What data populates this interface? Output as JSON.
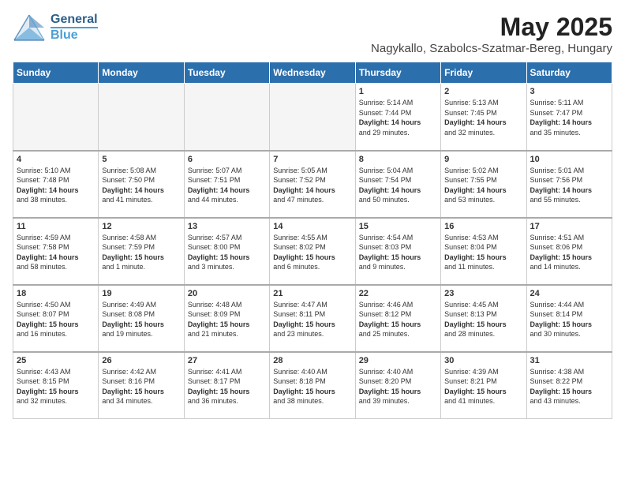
{
  "logo": {
    "line1": "General",
    "line2": "Blue"
  },
  "title": "May 2025",
  "location": "Nagykallo, Szabolcs-Szatmar-Bereg, Hungary",
  "headers": [
    "Sunday",
    "Monday",
    "Tuesday",
    "Wednesday",
    "Thursday",
    "Friday",
    "Saturday"
  ],
  "weeks": [
    [
      {
        "day": "",
        "info": ""
      },
      {
        "day": "",
        "info": ""
      },
      {
        "day": "",
        "info": ""
      },
      {
        "day": "",
        "info": ""
      },
      {
        "day": "1",
        "info": "Sunrise: 5:14 AM\nSunset: 7:44 PM\nDaylight: 14 hours\nand 29 minutes."
      },
      {
        "day": "2",
        "info": "Sunrise: 5:13 AM\nSunset: 7:45 PM\nDaylight: 14 hours\nand 32 minutes."
      },
      {
        "day": "3",
        "info": "Sunrise: 5:11 AM\nSunset: 7:47 PM\nDaylight: 14 hours\nand 35 minutes."
      }
    ],
    [
      {
        "day": "4",
        "info": "Sunrise: 5:10 AM\nSunset: 7:48 PM\nDaylight: 14 hours\nand 38 minutes."
      },
      {
        "day": "5",
        "info": "Sunrise: 5:08 AM\nSunset: 7:50 PM\nDaylight: 14 hours\nand 41 minutes."
      },
      {
        "day": "6",
        "info": "Sunrise: 5:07 AM\nSunset: 7:51 PM\nDaylight: 14 hours\nand 44 minutes."
      },
      {
        "day": "7",
        "info": "Sunrise: 5:05 AM\nSunset: 7:52 PM\nDaylight: 14 hours\nand 47 minutes."
      },
      {
        "day": "8",
        "info": "Sunrise: 5:04 AM\nSunset: 7:54 PM\nDaylight: 14 hours\nand 50 minutes."
      },
      {
        "day": "9",
        "info": "Sunrise: 5:02 AM\nSunset: 7:55 PM\nDaylight: 14 hours\nand 53 minutes."
      },
      {
        "day": "10",
        "info": "Sunrise: 5:01 AM\nSunset: 7:56 PM\nDaylight: 14 hours\nand 55 minutes."
      }
    ],
    [
      {
        "day": "11",
        "info": "Sunrise: 4:59 AM\nSunset: 7:58 PM\nDaylight: 14 hours\nand 58 minutes."
      },
      {
        "day": "12",
        "info": "Sunrise: 4:58 AM\nSunset: 7:59 PM\nDaylight: 15 hours\nand 1 minute."
      },
      {
        "day": "13",
        "info": "Sunrise: 4:57 AM\nSunset: 8:00 PM\nDaylight: 15 hours\nand 3 minutes."
      },
      {
        "day": "14",
        "info": "Sunrise: 4:55 AM\nSunset: 8:02 PM\nDaylight: 15 hours\nand 6 minutes."
      },
      {
        "day": "15",
        "info": "Sunrise: 4:54 AM\nSunset: 8:03 PM\nDaylight: 15 hours\nand 9 minutes."
      },
      {
        "day": "16",
        "info": "Sunrise: 4:53 AM\nSunset: 8:04 PM\nDaylight: 15 hours\nand 11 minutes."
      },
      {
        "day": "17",
        "info": "Sunrise: 4:51 AM\nSunset: 8:06 PM\nDaylight: 15 hours\nand 14 minutes."
      }
    ],
    [
      {
        "day": "18",
        "info": "Sunrise: 4:50 AM\nSunset: 8:07 PM\nDaylight: 15 hours\nand 16 minutes."
      },
      {
        "day": "19",
        "info": "Sunrise: 4:49 AM\nSunset: 8:08 PM\nDaylight: 15 hours\nand 19 minutes."
      },
      {
        "day": "20",
        "info": "Sunrise: 4:48 AM\nSunset: 8:09 PM\nDaylight: 15 hours\nand 21 minutes."
      },
      {
        "day": "21",
        "info": "Sunrise: 4:47 AM\nSunset: 8:11 PM\nDaylight: 15 hours\nand 23 minutes."
      },
      {
        "day": "22",
        "info": "Sunrise: 4:46 AM\nSunset: 8:12 PM\nDaylight: 15 hours\nand 25 minutes."
      },
      {
        "day": "23",
        "info": "Sunrise: 4:45 AM\nSunset: 8:13 PM\nDaylight: 15 hours\nand 28 minutes."
      },
      {
        "day": "24",
        "info": "Sunrise: 4:44 AM\nSunset: 8:14 PM\nDaylight: 15 hours\nand 30 minutes."
      }
    ],
    [
      {
        "day": "25",
        "info": "Sunrise: 4:43 AM\nSunset: 8:15 PM\nDaylight: 15 hours\nand 32 minutes."
      },
      {
        "day": "26",
        "info": "Sunrise: 4:42 AM\nSunset: 8:16 PM\nDaylight: 15 hours\nand 34 minutes."
      },
      {
        "day": "27",
        "info": "Sunrise: 4:41 AM\nSunset: 8:17 PM\nDaylight: 15 hours\nand 36 minutes."
      },
      {
        "day": "28",
        "info": "Sunrise: 4:40 AM\nSunset: 8:18 PM\nDaylight: 15 hours\nand 38 minutes."
      },
      {
        "day": "29",
        "info": "Sunrise: 4:40 AM\nSunset: 8:20 PM\nDaylight: 15 hours\nand 39 minutes."
      },
      {
        "day": "30",
        "info": "Sunrise: 4:39 AM\nSunset: 8:21 PM\nDaylight: 15 hours\nand 41 minutes."
      },
      {
        "day": "31",
        "info": "Sunrise: 4:38 AM\nSunset: 8:22 PM\nDaylight: 15 hours\nand 43 minutes."
      }
    ]
  ]
}
